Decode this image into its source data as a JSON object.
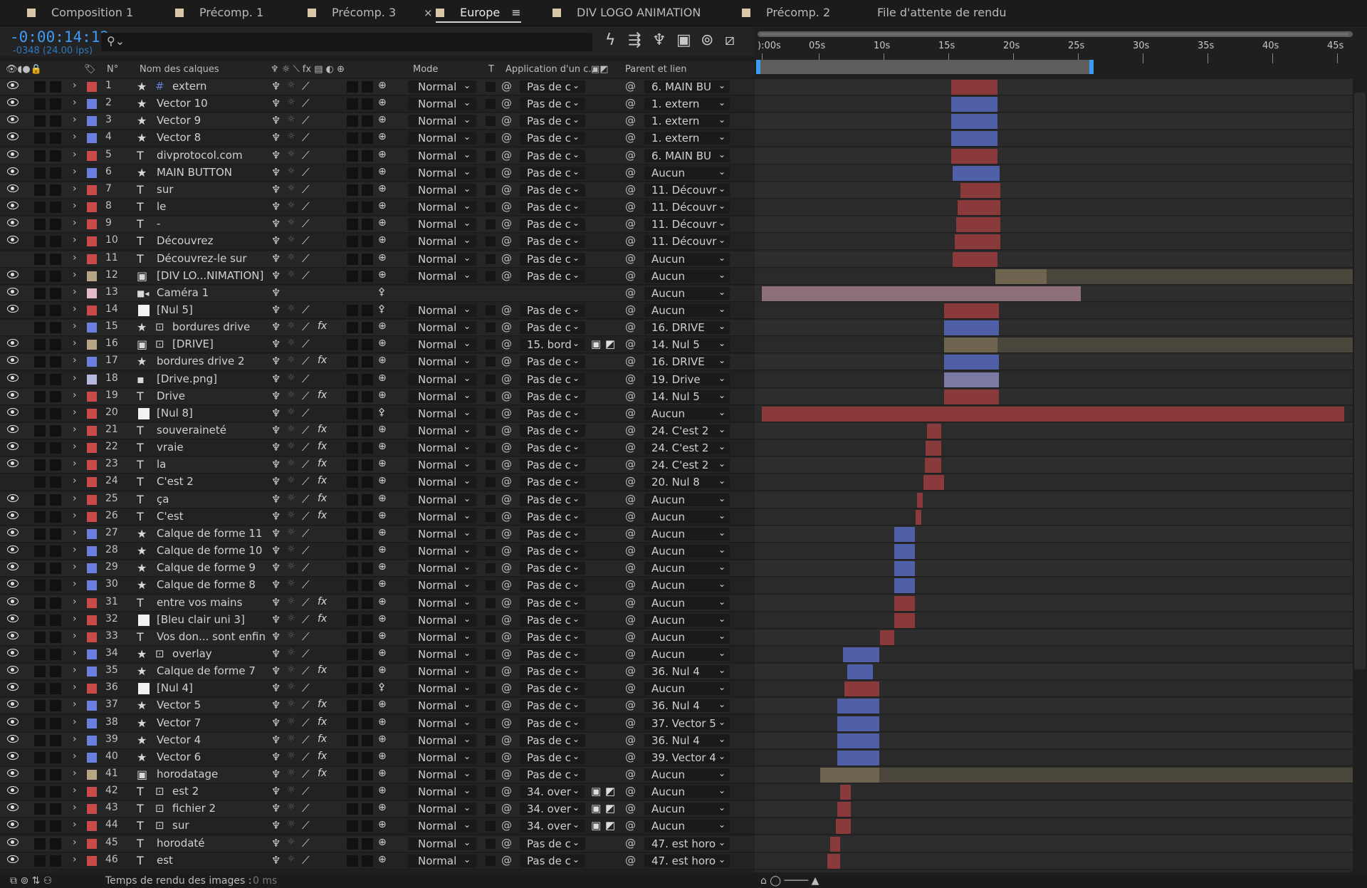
{
  "tabs": [
    {
      "label": "Composition 1",
      "color": "#d8c8a8"
    },
    {
      "label": "Précomp. 1",
      "color": "#d8c8a8"
    },
    {
      "label": "Précomp. 3",
      "color": "#d8c8a8"
    },
    {
      "label": "Europe",
      "color": "#d8c8a8",
      "active": true,
      "close": "×",
      "menu": "≡"
    },
    {
      "label": "DIV LOGO ANIMATION",
      "color": "#d8c8a8"
    },
    {
      "label": "Précomp. 2",
      "color": "#d8c8a8"
    },
    {
      "label": "File d'attente de rendu",
      "color": ""
    }
  ],
  "timecode": {
    "main": "-0:00:14:12",
    "sub": "-0348 (24.00 ips)"
  },
  "columns": {
    "num": "N°",
    "name": "Nom des calques",
    "mode": "Mode",
    "t": "T",
    "app": "Application d'un c...",
    "parent": "Parent et lien"
  },
  "ruler": [
    "):00s",
    "05s",
    "10s",
    "15s",
    "20s",
    "25s",
    "30s",
    "35s",
    "40s",
    "45s"
  ],
  "footer": {
    "label": "Temps de rendu des images :",
    "value": "0 ms"
  },
  "colors": {
    "red": "#c94a4a",
    "blue": "#6b7fde",
    "tan": "#b7a684",
    "pink": "#e4b9c9",
    "white": "#f2f2f2",
    "lav": "#b8b8de",
    "accent": "#3d9bf3"
  },
  "layers": [
    {
      "n": "1",
      "type": "star-hash",
      "name": "extern",
      "label": "red",
      "mode": "Normal",
      "app": "Pas de c",
      "parent": "6. MAIN BU",
      "bar": [
        1336,
        1401,
        "#8a3a3a"
      ]
    },
    {
      "n": "2",
      "type": "star",
      "name": "Vector 10",
      "label": "blue",
      "mode": "Normal",
      "app": "Pas de c",
      "parent": "1. extern",
      "bar": [
        1336,
        1401,
        "#4f5fa8"
      ]
    },
    {
      "n": "3",
      "type": "star",
      "name": "Vector 9",
      "label": "blue",
      "mode": "Normal",
      "app": "Pas de c",
      "parent": "1. extern",
      "bar": [
        1336,
        1401,
        "#4f5fa8"
      ]
    },
    {
      "n": "4",
      "type": "star",
      "name": "Vector 8",
      "label": "blue",
      "mode": "Normal",
      "app": "Pas de c",
      "parent": "1. extern",
      "bar": [
        1336,
        1401,
        "#4f5fa8"
      ]
    },
    {
      "n": "5",
      "type": "T",
      "name": "divprotocol.com",
      "label": "red",
      "mode": "Normal",
      "app": "Pas de c",
      "parent": "6. MAIN BU",
      "bar": [
        1336,
        1401,
        "#8a3a3a"
      ]
    },
    {
      "n": "6",
      "type": "star",
      "name": "MAIN BUTTON",
      "label": "blue",
      "mode": "Normal",
      "app": "Pas de c",
      "parent": "Aucun",
      "bar": [
        1338,
        1404,
        "#4f5fa8"
      ]
    },
    {
      "n": "7",
      "type": "T",
      "name": "sur",
      "label": "red",
      "mode": "Normal",
      "app": "Pas de c",
      "parent": "11. Découvr",
      "bar": [
        1349,
        1405,
        "#8a3a3a"
      ]
    },
    {
      "n": "8",
      "type": "T",
      "name": "le",
      "label": "red",
      "mode": "Normal",
      "app": "Pas de c",
      "parent": "11. Découvr",
      "bar": [
        1345,
        1405,
        "#8a3a3a"
      ]
    },
    {
      "n": "9",
      "type": "T",
      "name": "-",
      "label": "red",
      "mode": "Normal",
      "app": "Pas de c",
      "parent": "11. Découvr",
      "bar": [
        1343,
        1405,
        "#8a3a3a"
      ]
    },
    {
      "n": "10",
      "type": "T",
      "name": "Découvrez",
      "label": "red",
      "mode": "Normal",
      "app": "Pas de c",
      "parent": "11. Découvr",
      "bar": [
        1341,
        1405,
        "#8a3a3a"
      ]
    },
    {
      "n": "11",
      "type": "T",
      "name": "Découvrez-le sur",
      "label": "red",
      "mode": "Normal",
      "app": "Pas de c",
      "parent": "Aucun",
      "bar": [
        1338,
        1401,
        "#8a3a3a"
      ],
      "hidden": true
    },
    {
      "n": "12",
      "type": "precomp",
      "name": "[DIV LO...NIMATION]",
      "label": "tan",
      "mode": "Normal",
      "app": "Pas de c",
      "parent": "Aucun",
      "bar": [
        1398,
        1470,
        "#6e6450"
      ],
      "bar2": [
        1470,
        1900,
        "#4a463c"
      ]
    },
    {
      "n": "13",
      "type": "camera",
      "name": "Caméra 1",
      "label": "pink",
      "mode": "",
      "app": "",
      "parent": "Aucun",
      "bar": [
        1070,
        1518,
        "#8c6f7a"
      ]
    },
    {
      "n": "14",
      "type": "white",
      "name": "[Nul 5]",
      "label": "red",
      "mode": "Normal",
      "app": "Pas de c",
      "parent": "Aucun",
      "bar": [
        1326,
        1403,
        "#8a3a3a"
      ]
    },
    {
      "n": "15",
      "type": "star-box",
      "name": "bordures drive",
      "label": "blue",
      "mode": "Normal",
      "app": "Pas de c",
      "parent": "16. DRIVE",
      "bar": [
        1326,
        1403,
        "#4f5fa8"
      ],
      "fx": true,
      "hidden": true
    },
    {
      "n": "16",
      "type": "precomp-box",
      "name": "[DRIVE]",
      "label": "tan",
      "mode": "Normal",
      "app": "15. bord",
      "parent": "14. Nul 5",
      "bar": [
        1326,
        1401,
        "#6e6450"
      ],
      "bar2": [
        1401,
        1900,
        "#4a463c"
      ],
      "tt": true
    },
    {
      "n": "17",
      "type": "star",
      "name": "bordures drive 2",
      "label": "blue",
      "mode": "Normal",
      "app": "Pas de c",
      "parent": "16. DRIVE",
      "bar": [
        1326,
        1403,
        "#4f5fa8"
      ],
      "fx": true
    },
    {
      "n": "18",
      "type": "file",
      "name": "[Drive.png]",
      "label": "lav",
      "mode": "Normal",
      "app": "Pas de c",
      "parent": "19. Drive",
      "bar": [
        1326,
        1403,
        "#7a7aa4"
      ]
    },
    {
      "n": "19",
      "type": "T",
      "name": "Drive",
      "label": "red",
      "mode": "Normal",
      "app": "Pas de c",
      "parent": "14. Nul 5",
      "bar": [
        1326,
        1403,
        "#8a3a3a"
      ],
      "fx": true
    },
    {
      "n": "20",
      "type": "white",
      "name": "[Nul 8]",
      "label": "red",
      "mode": "Normal",
      "app": "Pas de c",
      "parent": "Aucun",
      "bar": [
        1070,
        1888,
        "#8a3a3a"
      ]
    },
    {
      "n": "21",
      "type": "T",
      "name": "souveraineté",
      "label": "red",
      "mode": "Normal",
      "app": "Pas de c",
      "parent": "24. C'est 2",
      "bar": [
        1302,
        1322,
        "#8a3a3a"
      ],
      "fx": true
    },
    {
      "n": "22",
      "type": "T",
      "name": "vraie",
      "label": "red",
      "mode": "Normal",
      "app": "Pas de c",
      "parent": "24. C'est 2",
      "bar": [
        1300,
        1322,
        "#8a3a3a"
      ],
      "fx": true
    },
    {
      "n": "23",
      "type": "T",
      "name": "la",
      "label": "red",
      "mode": "Normal",
      "app": "Pas de c",
      "parent": "24. C'est 2",
      "bar": [
        1299,
        1322,
        "#8a3a3a"
      ],
      "fx": true
    },
    {
      "n": "24",
      "type": "T",
      "name": "C'est 2",
      "label": "red",
      "mode": "Normal",
      "app": "Pas de c",
      "parent": "20. Nul 8",
      "bar": [
        1297,
        1326,
        "#8a3a3a"
      ],
      "fx": true,
      "hidden": true
    },
    {
      "n": "25",
      "type": "T",
      "name": "ça",
      "label": "red",
      "mode": "Normal",
      "app": "Pas de c",
      "parent": "Aucun",
      "bar": [
        1288,
        1296,
        "#8a3a3a"
      ],
      "fx": true
    },
    {
      "n": "26",
      "type": "T",
      "name": "C'est",
      "label": "red",
      "mode": "Normal",
      "app": "Pas de c",
      "parent": "Aucun",
      "bar": [
        1286,
        1294,
        "#8a3a3a"
      ],
      "fx": true
    },
    {
      "n": "27",
      "type": "star",
      "name": "Calque de forme 11",
      "label": "blue",
      "mode": "Normal",
      "app": "Pas de c",
      "parent": "Aucun",
      "bar": [
        1256,
        1285,
        "#4f5fa8"
      ]
    },
    {
      "n": "28",
      "type": "star",
      "name": "Calque de forme 10",
      "label": "blue",
      "mode": "Normal",
      "app": "Pas de c",
      "parent": "Aucun",
      "bar": [
        1256,
        1285,
        "#4f5fa8"
      ]
    },
    {
      "n": "29",
      "type": "star",
      "name": "Calque de forme 9",
      "label": "blue",
      "mode": "Normal",
      "app": "Pas de c",
      "parent": "Aucun",
      "bar": [
        1256,
        1285,
        "#4f5fa8"
      ]
    },
    {
      "n": "30",
      "type": "star",
      "name": "Calque de forme 8",
      "label": "blue",
      "mode": "Normal",
      "app": "Pas de c",
      "parent": "Aucun",
      "bar": [
        1256,
        1285,
        "#4f5fa8"
      ]
    },
    {
      "n": "31",
      "type": "T",
      "name": "entre vos mains",
      "label": "red",
      "mode": "Normal",
      "app": "Pas de c",
      "parent": "Aucun",
      "bar": [
        1256,
        1285,
        "#8a3a3a"
      ],
      "fx": true
    },
    {
      "n": "32",
      "type": "white",
      "name": "[Bleu clair uni 3]",
      "label": "red",
      "mode": "Normal",
      "app": "Pas de c",
      "parent": "Aucun",
      "bar": [
        1256,
        1285,
        "#8a3a3a"
      ],
      "fx": true
    },
    {
      "n": "33",
      "type": "T",
      "name": "Vos don... sont enfin",
      "label": "red",
      "mode": "Normal",
      "app": "Pas de c",
      "parent": "Aucun",
      "bar": [
        1236,
        1256,
        "#8a3a3a"
      ]
    },
    {
      "n": "34",
      "type": "star-box",
      "name": "overlay",
      "label": "blue",
      "mode": "Normal",
      "app": "Pas de c",
      "parent": "Aucun",
      "bar": [
        1184,
        1235,
        "#4f5fa8"
      ]
    },
    {
      "n": "35",
      "type": "star",
      "name": "Calque de forme 7",
      "label": "blue",
      "mode": "Normal",
      "app": "Pas de c",
      "parent": "36. Nul 4",
      "bar": [
        1190,
        1226,
        "#4f5fa8"
      ],
      "fx": true
    },
    {
      "n": "36",
      "type": "white",
      "name": "[Nul 4]",
      "label": "red",
      "mode": "Normal",
      "app": "Pas de c",
      "parent": "Aucun",
      "bar": [
        1186,
        1235,
        "#8a3a3a"
      ]
    },
    {
      "n": "37",
      "type": "star",
      "name": "Vector 5",
      "label": "blue",
      "mode": "Normal",
      "app": "Pas de c",
      "parent": "36. Nul 4",
      "bar": [
        1176,
        1235,
        "#4f5fa8"
      ],
      "fx": true
    },
    {
      "n": "38",
      "type": "star",
      "name": "Vector 7",
      "label": "blue",
      "mode": "Normal",
      "app": "Pas de c",
      "parent": "37. Vector 5",
      "bar": [
        1176,
        1235,
        "#4f5fa8"
      ],
      "fx": true
    },
    {
      "n": "39",
      "type": "star",
      "name": "Vector 4",
      "label": "blue",
      "mode": "Normal",
      "app": "Pas de c",
      "parent": "36. Nul 4",
      "bar": [
        1176,
        1235,
        "#4f5fa8"
      ],
      "fx": true
    },
    {
      "n": "40",
      "type": "star",
      "name": "Vector 6",
      "label": "blue",
      "mode": "Normal",
      "app": "Pas de c",
      "parent": "39. Vector 4",
      "bar": [
        1176,
        1235,
        "#4f5fa8"
      ],
      "fx": true
    },
    {
      "n": "41",
      "type": "precomp",
      "name": "horodatage",
      "label": "tan",
      "mode": "Normal",
      "app": "Pas de c",
      "parent": "Aucun",
      "bar": [
        1152,
        1235,
        "#6e6450"
      ],
      "bar2": [
        1235,
        1900,
        "#4a463c"
      ],
      "fx": true
    },
    {
      "n": "42",
      "type": "T-box",
      "name": "est 2",
      "label": "red",
      "mode": "Normal",
      "app": "34. over",
      "parent": "Aucun",
      "bar": [
        1180,
        1195,
        "#8a3a3a"
      ],
      "tt": true
    },
    {
      "n": "43",
      "type": "T-box",
      "name": "fichier 2",
      "label": "red",
      "mode": "Normal",
      "app": "34. over",
      "parent": "Aucun",
      "bar": [
        1176,
        1195,
        "#8a3a3a"
      ],
      "tt": true
    },
    {
      "n": "44",
      "type": "T-box",
      "name": "sur",
      "label": "red",
      "mode": "Normal",
      "app": "34. over",
      "parent": "Aucun",
      "bar": [
        1174,
        1195,
        "#8a3a3a"
      ],
      "tt": true
    },
    {
      "n": "45",
      "type": "T",
      "name": "horodaté",
      "label": "red",
      "mode": "Normal",
      "app": "Pas de c",
      "parent": "47. est horo",
      "bar": [
        1166,
        1180,
        "#8a3a3a"
      ]
    },
    {
      "n": "46",
      "type": "T",
      "name": "est",
      "label": "red",
      "mode": "Normal",
      "app": "Pas de c",
      "parent": "47. est horo",
      "bar": [
        1162,
        1180,
        "#8a3a3a"
      ]
    }
  ]
}
